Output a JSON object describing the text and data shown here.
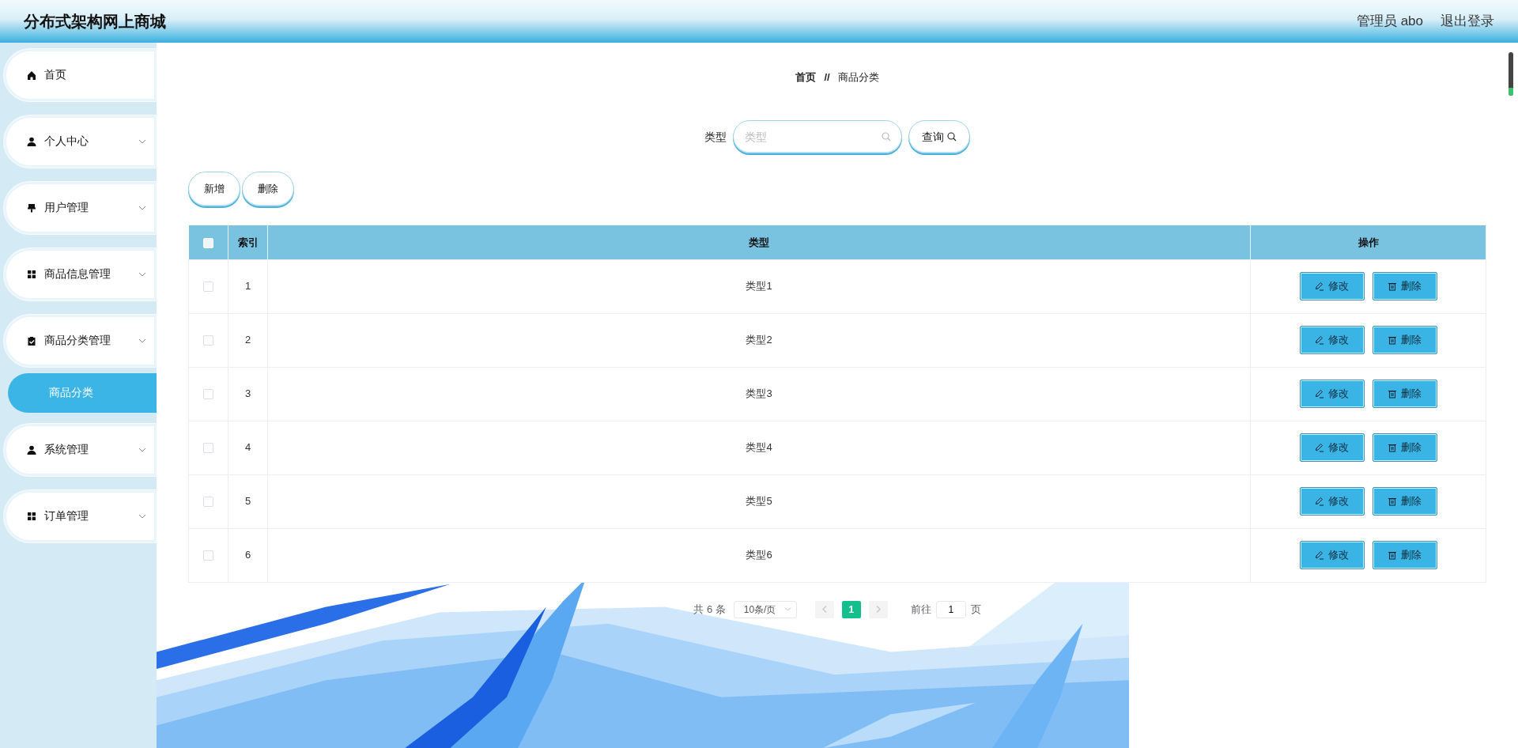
{
  "header": {
    "title": "分布式架构网上商城",
    "user": "管理员 abo",
    "logout": "退出登录"
  },
  "sidebar": {
    "items": [
      {
        "label": "首页"
      },
      {
        "label": "个人中心",
        "has_submenu": true
      },
      {
        "label": "用户管理",
        "has_submenu": true
      },
      {
        "label": "商品信息管理",
        "has_submenu": true
      },
      {
        "label": "商品分类管理",
        "has_submenu": true,
        "children": [
          {
            "label": "商品分类",
            "selected": true
          }
        ]
      },
      {
        "label": "系统管理",
        "has_submenu": true
      },
      {
        "label": "订单管理",
        "has_submenu": true
      }
    ]
  },
  "breadcrumb": {
    "items": [
      "首页",
      "商品分类"
    ],
    "separator": "//"
  },
  "search": {
    "label": "类型",
    "placeholder": "类型",
    "button": "查询"
  },
  "actions": [
    "新增",
    "删除"
  ],
  "table": {
    "header_checked": false,
    "columns": [
      "索引",
      "类型",
      "操作"
    ],
    "rows": [
      {
        "checked": false,
        "index": "1",
        "type": "类型1",
        "actions": [
          "修改",
          "删除"
        ]
      },
      {
        "checked": false,
        "index": "2",
        "type": "类型2",
        "actions": [
          "修改",
          "删除"
        ]
      },
      {
        "checked": false,
        "index": "3",
        "type": "类型3",
        "actions": [
          "修改",
          "删除"
        ]
      },
      {
        "checked": false,
        "index": "4",
        "type": "类型4",
        "actions": [
          "修改",
          "删除"
        ]
      },
      {
        "checked": false,
        "index": "5",
        "type": "类型5",
        "actions": [
          "修改",
          "删除"
        ]
      },
      {
        "checked": false,
        "index": "6",
        "type": "类型6",
        "actions": [
          "修改",
          "删除"
        ]
      }
    ]
  },
  "pagination": {
    "total": "共 6 条",
    "page_size": "10条/页",
    "prev_disabled": true,
    "next_disabled": true,
    "pages": [
      {
        "label": "1",
        "selected": true
      }
    ],
    "goto_label": "前往",
    "goto_value": "1",
    "goto_suffix": "页"
  }
}
